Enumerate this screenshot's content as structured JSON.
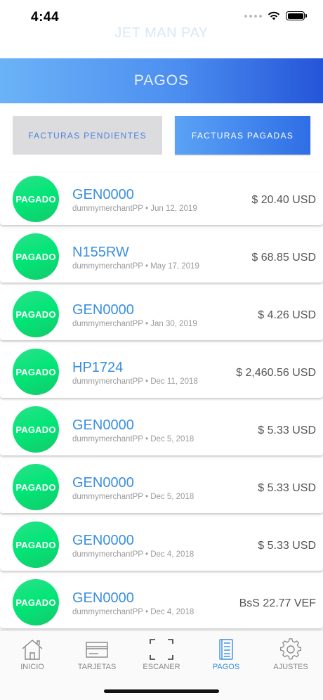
{
  "status_bar": {
    "time": "4:44"
  },
  "brand": "JET MAN PAY",
  "header": {
    "title": "PAGOS"
  },
  "tabs": {
    "pending": "FACTURAS PENDIENTES",
    "paid": "FACTURAS PAGADAS"
  },
  "payments": [
    {
      "badge": "PAGADO",
      "ref": "GEN0000",
      "merchant": "dummymerchantPP",
      "date": "Jun 12, 2019",
      "amount": "$ 20.40 USD"
    },
    {
      "badge": "PAGADO",
      "ref": "N155RW",
      "merchant": "dummymerchantPP",
      "date": "May 17, 2019",
      "amount": "$ 68.85 USD"
    },
    {
      "badge": "PAGADO",
      "ref": "GEN0000",
      "merchant": "dummymerchantPP",
      "date": "Jan 30, 2019",
      "amount": "$ 4.26 USD"
    },
    {
      "badge": "PAGADO",
      "ref": "HP1724",
      "merchant": "dummymerchantPP",
      "date": "Dec 11, 2018",
      "amount": "$ 2,460.56 USD"
    },
    {
      "badge": "PAGADO",
      "ref": "GEN0000",
      "merchant": "dummymerchantPP",
      "date": "Dec 5, 2018",
      "amount": "$ 5.33 USD"
    },
    {
      "badge": "PAGADO",
      "ref": "GEN0000",
      "merchant": "dummymerchantPP",
      "date": "Dec 5, 2018",
      "amount": "$ 5.33 USD"
    },
    {
      "badge": "PAGADO",
      "ref": "GEN0000",
      "merchant": "dummymerchantPP",
      "date": "Dec 4, 2018",
      "amount": "$ 5.33 USD"
    },
    {
      "badge": "PAGADO",
      "ref": "GEN0000",
      "merchant": "dummymerchantPP",
      "date": "Dec 4, 2018",
      "amount": "BsS 22.77 VEF"
    }
  ],
  "meta_separator": "•",
  "tabbar": [
    {
      "label": "INICIO",
      "icon": "home-icon",
      "active": false
    },
    {
      "label": "TARJETAS",
      "icon": "card-icon",
      "active": false
    },
    {
      "label": "ESCANER",
      "icon": "scan-icon",
      "active": false
    },
    {
      "label": "PAGOS",
      "icon": "receipt-icon",
      "active": true
    },
    {
      "label": "AJUSTES",
      "icon": "gear-icon",
      "active": false
    }
  ],
  "colors": {
    "accent": "#3a8fe0",
    "badge_green": "#00e676",
    "header_start": "#6bb3f7",
    "header_end": "#2455d8"
  }
}
